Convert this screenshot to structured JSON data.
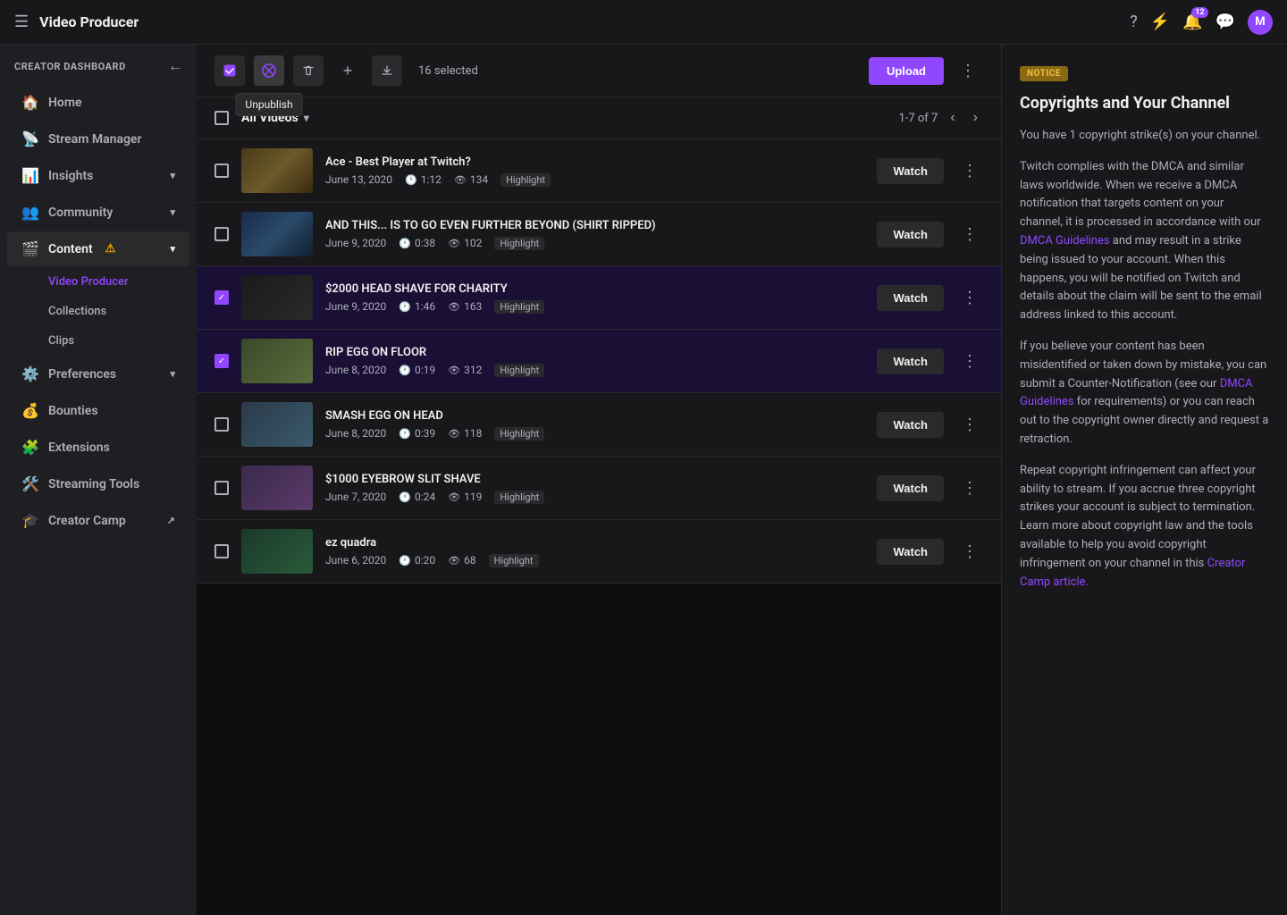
{
  "topNav": {
    "hamburger": "☰",
    "title": "Video Producer",
    "icons": {
      "help": "?",
      "hype": "⚡",
      "notifications": "🔔",
      "notifBadge": "12",
      "chat": "💬",
      "avatarInitial": "M"
    }
  },
  "sidebar": {
    "creatorDashboardLabel": "CREATOR DASHBOARD",
    "backIcon": "←",
    "items": [
      {
        "id": "home",
        "icon": "🏠",
        "label": "Home",
        "expandable": false
      },
      {
        "id": "stream-manager",
        "icon": "📡",
        "label": "Stream Manager",
        "expandable": false
      },
      {
        "id": "insights",
        "icon": "📊",
        "label": "Insights",
        "expandable": true
      },
      {
        "id": "community",
        "icon": "👥",
        "label": "Community",
        "expandable": true
      },
      {
        "id": "content",
        "icon": "🎬",
        "label": "Content",
        "expandable": true,
        "warning": true
      },
      {
        "id": "preferences",
        "icon": "⚙️",
        "label": "Preferences",
        "expandable": true
      },
      {
        "id": "bounties",
        "icon": "💰",
        "label": "Bounties",
        "expandable": false
      },
      {
        "id": "extensions",
        "icon": "🧩",
        "label": "Extensions",
        "expandable": false
      },
      {
        "id": "streaming-tools",
        "icon": "🛠️",
        "label": "Streaming Tools",
        "expandable": false
      },
      {
        "id": "creator-camp",
        "icon": "🎓",
        "label": "Creator Camp",
        "expandable": false,
        "external": true
      }
    ],
    "subItems": [
      {
        "id": "video-producer",
        "label": "Video Producer",
        "active": true
      },
      {
        "id": "collections",
        "label": "Collections",
        "active": false
      },
      {
        "id": "clips",
        "label": "Clips",
        "active": false
      }
    ]
  },
  "toolbar": {
    "selectAllIcon": "☑",
    "unpublishIcon": "🚫",
    "unpublishTooltip": "Unpublish",
    "deleteIcon": "🗑",
    "addIcon": "+",
    "downloadIcon": "⬇",
    "selectedCount": "16 selected",
    "uploadLabel": "Upload",
    "moreIcon": "⋮"
  },
  "videoList": {
    "allVideosLabel": "All Videos",
    "pagination": "1-7 of 7",
    "prevIcon": "‹",
    "nextIcon": "›",
    "videos": [
      {
        "id": 1,
        "title": "Ace - Best Player at Twitch?",
        "date": "June 13, 2020",
        "duration": "1:12",
        "views": "134",
        "type": "Highlight",
        "selected": false,
        "thumbClass": "thumb-1"
      },
      {
        "id": 2,
        "title": "AND THIS... IS TO GO EVEN FURTHER BEYOND (SHIRT RIPPED)",
        "date": "June 9, 2020",
        "duration": "0:38",
        "views": "102",
        "type": "Highlight",
        "selected": false,
        "thumbClass": "thumb-2"
      },
      {
        "id": 3,
        "title": "$2000 HEAD SHAVE FOR CHARITY",
        "date": "June 9, 2020",
        "duration": "1:46",
        "views": "163",
        "type": "Highlight",
        "selected": true,
        "thumbClass": "thumb-3"
      },
      {
        "id": 4,
        "title": "RIP EGG ON FLOOR",
        "date": "June 8, 2020",
        "duration": "0:19",
        "views": "312",
        "type": "Highlight",
        "selected": true,
        "thumbClass": "thumb-4"
      },
      {
        "id": 5,
        "title": "SMASH EGG ON HEAD",
        "date": "June 8, 2020",
        "duration": "0:39",
        "views": "118",
        "type": "Highlight",
        "selected": false,
        "thumbClass": "thumb-5"
      },
      {
        "id": 6,
        "title": "$1000 EYEBROW SLIT SHAVE",
        "date": "June 7, 2020",
        "duration": "0:24",
        "views": "119",
        "type": "Highlight",
        "selected": false,
        "thumbClass": "thumb-6"
      },
      {
        "id": 7,
        "title": "ez quadra",
        "date": "June 6, 2020",
        "duration": "0:20",
        "views": "68",
        "type": "Highlight",
        "selected": false,
        "thumbClass": "thumb-7"
      }
    ],
    "watchLabel": "Watch",
    "moreIcon": "⋮"
  },
  "rightPanel": {
    "noticeBadge": "NOTICE",
    "noticeTitle": "Copyrights and Your Channel",
    "paragraphs": [
      "You have 1 copyright strike(s) on your channel.",
      "Twitch complies with the DMCA and similar laws worldwide. When we receive a DMCA notification that targets content on your channel, it is processed in accordance with our DMCA Guidelines and may result in a strike being issued to your account. When this happens, you will be notified on Twitch and details about the claim will be sent to the email address linked to this account.",
      "If you believe your content has been misidentified or taken down by mistake, you can submit a Counter-Notification (see our DMCA Guidelines for requirements) or you can reach out to the copyright owner directly and request a retraction.",
      "Repeat copyright infringement can affect your ability to stream. If you accrue three copyright strikes your account is subject to termination. Learn more about copyright law and the tools available to help you avoid copyright infringement on your channel in this Creator Camp article."
    ],
    "links": {
      "dmcaGuidelines1": "DMCA Guidelines",
      "dmcaGuidelines2": "DMCA Guidelines",
      "creatorCamp": "Creator Camp article."
    }
  }
}
